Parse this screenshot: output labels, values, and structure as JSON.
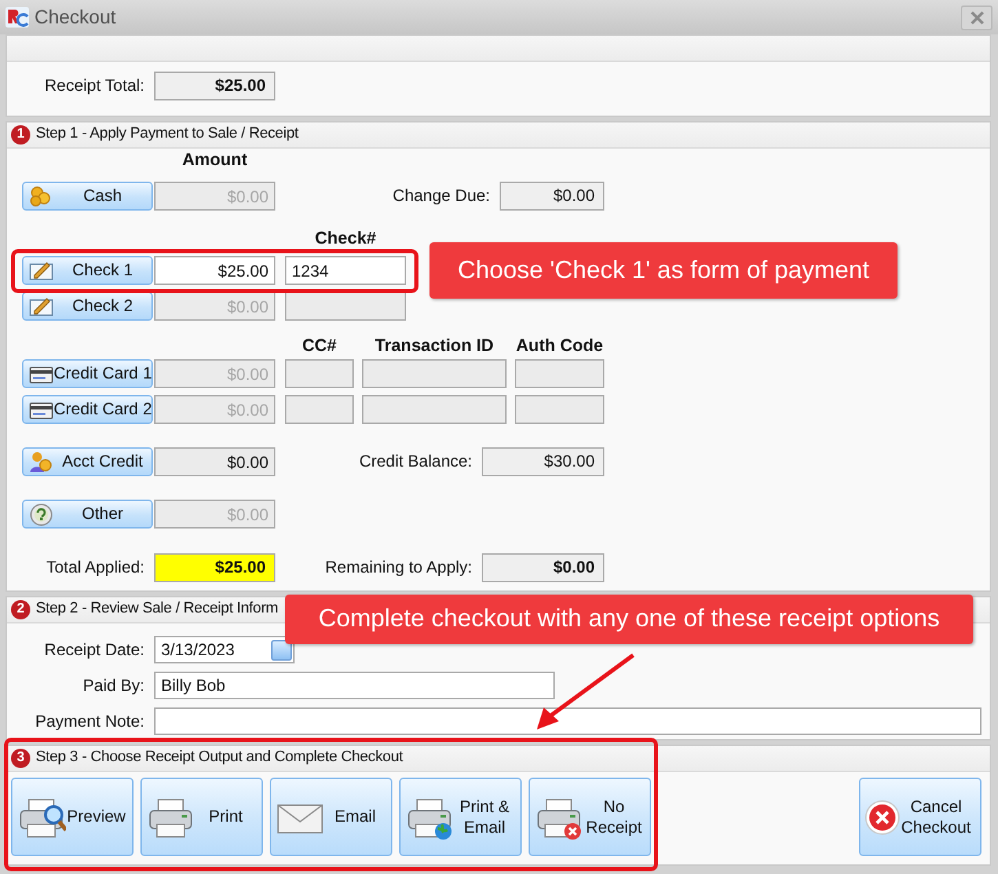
{
  "window": {
    "title": "Checkout"
  },
  "receipt_total": {
    "label": "Receipt Total:",
    "value": "$25.00"
  },
  "step1": {
    "number": "1",
    "title": "Step 1 - Apply Payment to Sale / Receipt",
    "columns": {
      "amount": "Amount",
      "check_number": "Check#",
      "cc_number": "CC#",
      "transaction_id": "Transaction ID",
      "auth_code": "Auth Code"
    },
    "payments": [
      {
        "kind": "cash",
        "label": "Cash",
        "amount": "$0.00",
        "disabled": true,
        "readonly": true,
        "side": {
          "label": "Change Due:",
          "value": "$0.00"
        }
      },
      {
        "kind": "check",
        "label": "Check 1",
        "amount": "$25.00",
        "check_number": "1234",
        "disabled": false,
        "readonly": false
      },
      {
        "kind": "check",
        "label": "Check 2",
        "amount": "$0.00",
        "disabled": true,
        "readonly": true
      },
      {
        "kind": "card",
        "label": "Credit Card 1",
        "amount": "$0.00",
        "disabled": true,
        "readonly": true
      },
      {
        "kind": "card",
        "label": "Credit Card 2",
        "amount": "$0.00",
        "disabled": true,
        "readonly": true
      },
      {
        "kind": "credit",
        "label": "Acct Credit",
        "amount": "$0.00",
        "disabled": false,
        "readonly": true,
        "side": {
          "label": "Credit Balance:",
          "value": "$30.00"
        }
      },
      {
        "kind": "other",
        "label": "Other",
        "amount": "$0.00",
        "disabled": true,
        "readonly": true
      }
    ],
    "total_applied": {
      "label": "Total Applied:",
      "value": "$25.00"
    },
    "remaining": {
      "label": "Remaining to Apply:",
      "value": "$0.00"
    }
  },
  "step2": {
    "number": "2",
    "title": "Step 2 - Review Sale / Receipt Inform",
    "fields": [
      {
        "kind": "date",
        "label": "Receipt Date:",
        "value": "3/13/2023"
      },
      {
        "kind": "name",
        "label": "Paid By:",
        "value": "Billy Bob"
      },
      {
        "kind": "note",
        "label": "Payment Note:"
      }
    ]
  },
  "step3": {
    "number": "3",
    "title": "Step 3 - Choose Receipt Output and Complete Checkout",
    "buttons": [
      {
        "kind": "preview",
        "label": "Preview"
      },
      {
        "kind": "print",
        "label": "Print"
      },
      {
        "kind": "email",
        "label": "Email"
      },
      {
        "kind": "print_email",
        "label": "Print & Email"
      },
      {
        "kind": "no_receipt",
        "label": "No Receipt"
      }
    ],
    "cancel": {
      "label": "Cancel Checkout"
    }
  },
  "annotations": [
    {
      "kind": "payment",
      "text": "Choose 'Check 1' as form of payment"
    },
    {
      "kind": "receipt",
      "text": "Complete checkout with any one of these receipt options"
    }
  ]
}
